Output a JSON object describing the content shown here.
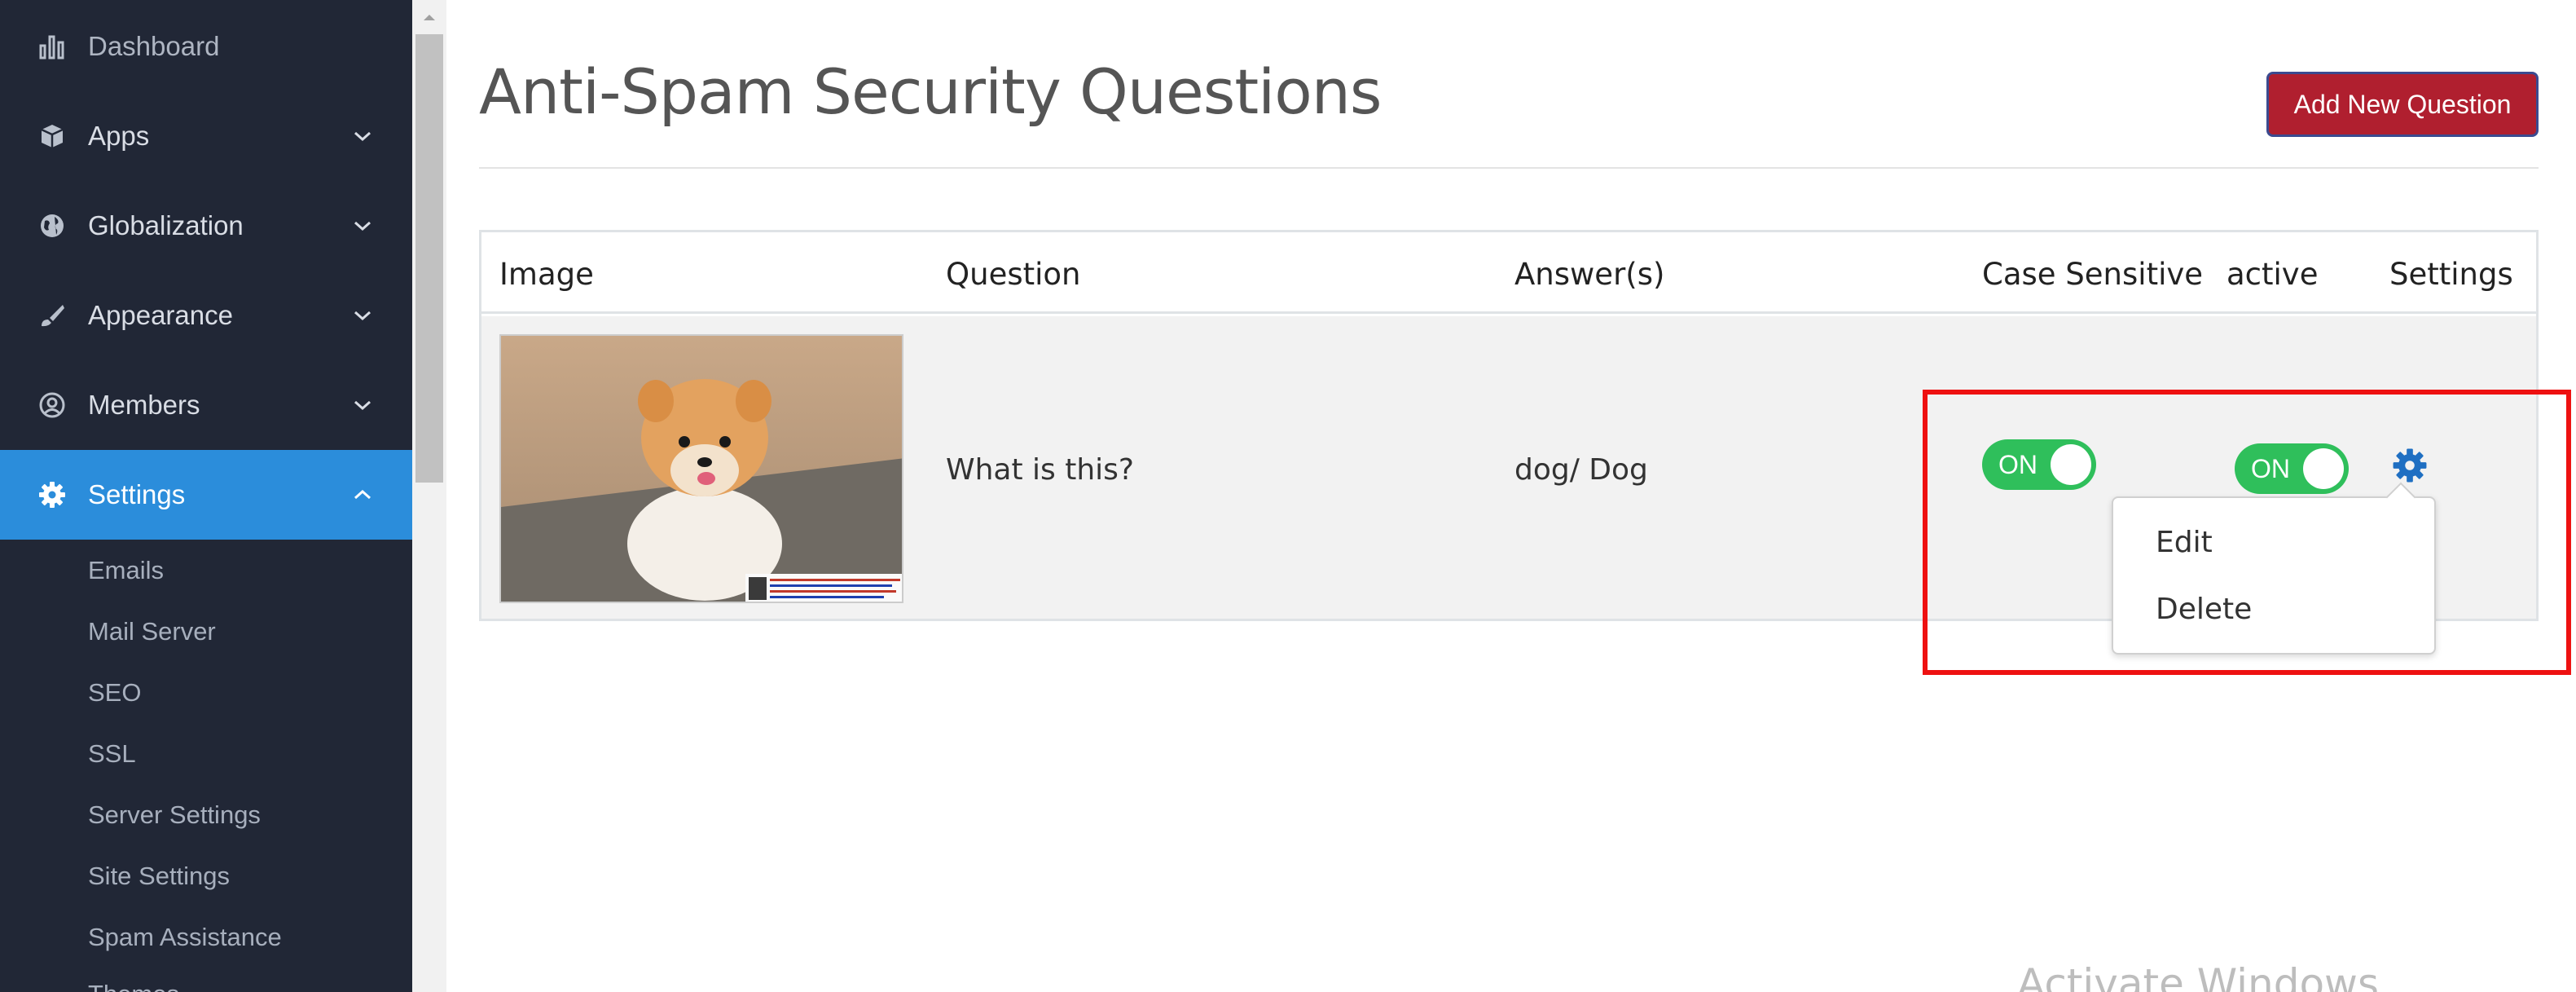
{
  "sidebar": {
    "items": [
      {
        "label": "Dashboard",
        "icon": "bar-chart-icon"
      },
      {
        "label": "Apps",
        "icon": "cube-icon"
      },
      {
        "label": "Globalization",
        "icon": "globe-icon"
      },
      {
        "label": "Appearance",
        "icon": "brush-icon"
      },
      {
        "label": "Members",
        "icon": "user-circle-icon"
      },
      {
        "label": "Settings",
        "icon": "gear-icon"
      }
    ],
    "sub_items": [
      "Emails",
      "Mail Server",
      "SEO",
      "SSL",
      "Server Settings",
      "Site Settings",
      "Spam Assistance",
      "Themes"
    ]
  },
  "page": {
    "title": "Anti-Spam Security Questions",
    "add_button": "Add New Question"
  },
  "table": {
    "headers": [
      "Image",
      "Question",
      "Answer(s)",
      "Case Sensitive",
      "active",
      "Settings"
    ],
    "rows": [
      {
        "image_alt": "Pomeranian puppy photo",
        "question": "What is this?",
        "answers": "dog/ Dog",
        "case_sensitive": "ON",
        "active": "ON"
      }
    ]
  },
  "dropdown": {
    "items": [
      "Edit",
      "Delete"
    ]
  },
  "watermark": "Activate Windows",
  "colors": {
    "sidebar_bg": "#212736",
    "active_nav": "#2b8ddb",
    "add_button": "#b01f2f",
    "toggle_on": "#2fbf5b",
    "highlight": "#ee1111",
    "gear": "#1f6fc2"
  }
}
